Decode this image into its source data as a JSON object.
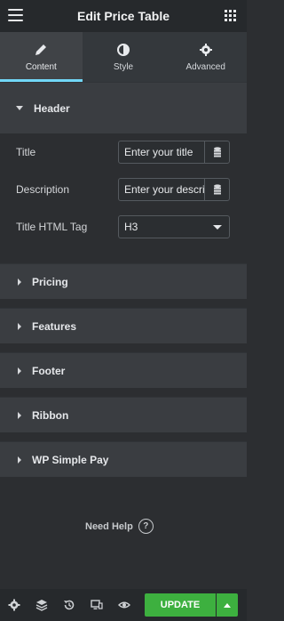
{
  "header": {
    "title": "Edit Price Table"
  },
  "tabs": [
    {
      "label": "Content",
      "icon": "pencil-icon",
      "active": true
    },
    {
      "label": "Style",
      "icon": "half-circle-icon",
      "active": false
    },
    {
      "label": "Advanced",
      "icon": "gear-icon",
      "active": false
    }
  ],
  "sections": {
    "header": {
      "label": "Header",
      "fields": {
        "title": {
          "label": "Title",
          "value": "Enter your title"
        },
        "description": {
          "label": "Description",
          "value": "Enter your description"
        },
        "title_tag": {
          "label": "Title HTML Tag",
          "value": "H3"
        }
      }
    },
    "collapsed": [
      "Pricing",
      "Features",
      "Footer",
      "Ribbon",
      "WP Simple Pay"
    ]
  },
  "need_help": {
    "label": "Need Help",
    "icon": "question-circle-icon"
  },
  "footer": {
    "icons": [
      "settings-icon",
      "layers-icon",
      "history-icon",
      "responsive-icon",
      "preview-eye-icon"
    ],
    "update_label": "UPDATE",
    "update_color": "#3db03f"
  },
  "colors": {
    "accent": "#71d7f7"
  }
}
